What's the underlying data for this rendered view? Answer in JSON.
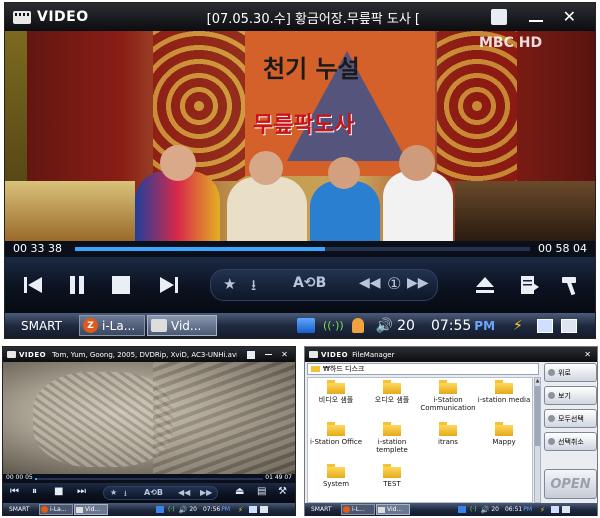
{
  "big": {
    "app_title": "VIDEO",
    "media_title": "[07.05.30.수] 황금어장.무릎팍 도사 [",
    "channel_logo": "MBC HD",
    "sign_line1": "천기 누설",
    "sign_line2": "무릎팍도사",
    "time_elapsed": "00 33 38",
    "time_remaining": "00 58 04",
    "progress": 0.55,
    "taskbar": {
      "start": "SMART",
      "task1": "i-La...",
      "task2": "Vid...",
      "volume": "20",
      "clock": "07:55",
      "ampm": "PM"
    },
    "ab_label": "A",
    "ab_label2": "B"
  },
  "left": {
    "app_title": "VIDEO",
    "media_title": "Tom, Yum, Goong, 2005, DVDRip, XviD, AC3-UNHi.avi",
    "time_elapsed": "00 00 05",
    "time_remaining": "01 49 07",
    "progress": 0.01,
    "taskbar": {
      "start": "SMART",
      "task1": "i-La...",
      "task2": "Vid...",
      "volume": "20",
      "clock": "07:56",
      "ampm": "PM"
    }
  },
  "fm": {
    "app_title": "VIDEO",
    "sub_title": "FileManager",
    "path": "₩하드 디스크",
    "folders": [
      "비디오 샘플",
      "오디오 샘플",
      "i-Station Communication",
      "i-station media",
      "i-Station Office",
      "i-station templete",
      "itrans",
      "Mappy",
      "System",
      "TEST"
    ],
    "side_buttons": [
      "위로",
      "보기",
      "모두선택",
      "선택취소"
    ],
    "open_label": "OPEN",
    "taskbar": {
      "start": "SMART",
      "task1": "i-L...",
      "task2": "Vid...",
      "volume": "20",
      "clock": "06:51",
      "ampm": "PM"
    }
  },
  "colors": {
    "accent": "#2e7cf6",
    "progress_fill": "#39a7ff",
    "folder": "#f3c235",
    "clock_pm": "#6aa8ff"
  }
}
